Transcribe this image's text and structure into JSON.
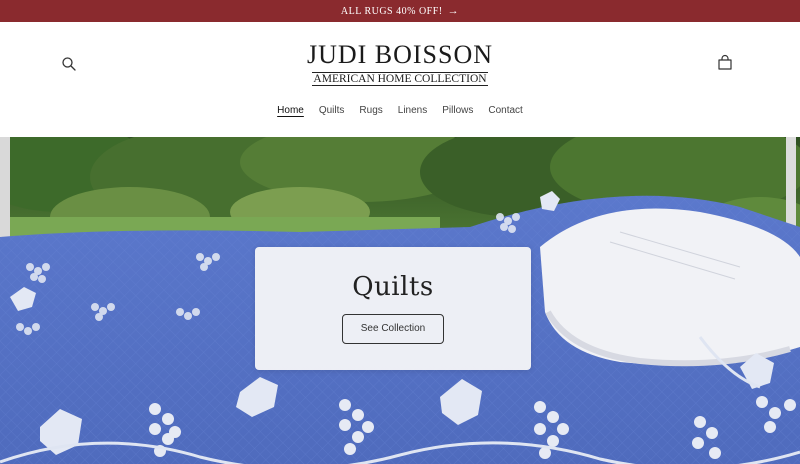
{
  "announcement": {
    "text": "ALL RUGS 40% OFF!",
    "arrow": "→"
  },
  "header": {
    "brand": "JUDI BOISSON",
    "subtitle": "AMERICAN HOME COLLECTION",
    "search_icon": "search-icon",
    "cart_icon": "cart-icon"
  },
  "nav": {
    "items": [
      {
        "label": "Home",
        "active": true
      },
      {
        "label": "Quilts"
      },
      {
        "label": "Rugs"
      },
      {
        "label": "Linens"
      },
      {
        "label": "Pillows"
      },
      {
        "label": "Contact"
      }
    ]
  },
  "hero": {
    "title": "Quilts",
    "button_label": "See Collection"
  },
  "colors": {
    "announcement_bg": "#8a2a2e",
    "quilt_blue": "#5e78c8",
    "foliage_green": "#3f6a2e"
  }
}
